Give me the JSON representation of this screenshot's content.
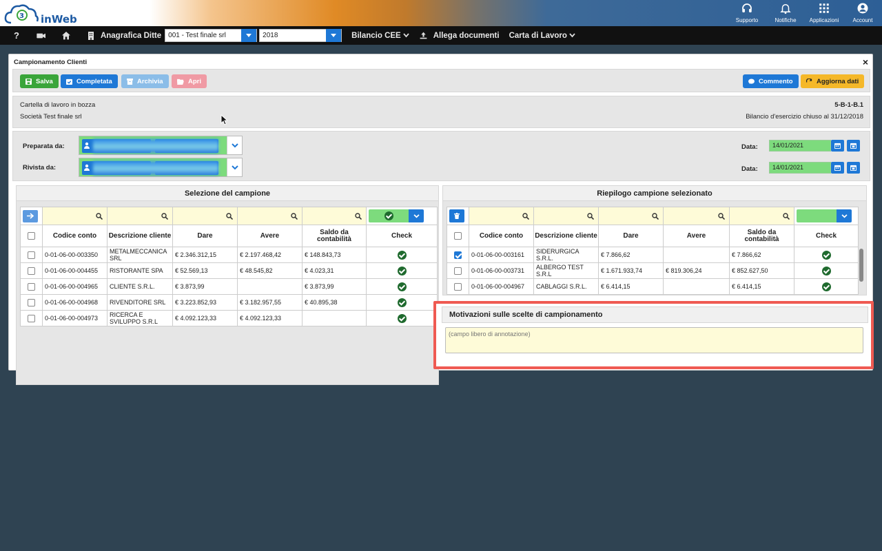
{
  "app": {
    "logo_text": "inWeb"
  },
  "topbar": {
    "items": [
      {
        "label": "Supporto",
        "icon": "headset-icon"
      },
      {
        "label": "Notifiche",
        "icon": "bell-icon"
      },
      {
        "label": "Applicazioni",
        "icon": "grid-icon"
      },
      {
        "label": "Account",
        "icon": "user-circle-icon"
      }
    ]
  },
  "navbar": {
    "help": "?",
    "anagrafica": "Anagrafica Ditte",
    "company_value": "001 - Test finale srl",
    "year_value": "2018",
    "bilancio": "Bilancio CEE",
    "allega": "Allega documenti",
    "carta": "Carta di Lavoro"
  },
  "panel": {
    "title": "Campionamento Clienti",
    "close": "×",
    "buttons": {
      "salva": "Salva",
      "completata": "Completata",
      "archivia": "Archivia",
      "apri": "Apri",
      "commento": "Commento",
      "aggiorna": "Aggiorna dati"
    },
    "info": {
      "status": "Cartella di lavoro in bozza",
      "company": "Società Test finale srl",
      "code": "5-B-1-B.1",
      "bilancio": "Bilancio d'esercizio chiuso al 31/12/2018"
    },
    "prep": {
      "preparata_label": "Preparata da:",
      "rivista_label": "Rivista da:",
      "data_label": "Data:",
      "date1": "14/01/2021",
      "date2": "14/01/2021"
    }
  },
  "left_grid": {
    "title": "Selezione del campione",
    "columns": [
      "Codice conto",
      "Descrizione cliente",
      "Dare",
      "Avere",
      "Saldo da contabilità",
      "Check"
    ],
    "rows": [
      {
        "codice": "0-01-06-00-003350",
        "desc": "METALMECCANICA SRL",
        "dare": "€ 2.346.312,15",
        "avere": "€ 2.197.468,42",
        "saldo": "€ 148.843,73"
      },
      {
        "codice": "0-01-06-00-004455",
        "desc": "RISTORANTE SPA",
        "dare": "€ 52.569,13",
        "avere": "€ 48.545,82",
        "saldo": "€ 4.023,31"
      },
      {
        "codice": "0-01-06-00-004965",
        "desc": "CLIENTE S.R.L.",
        "dare": "€ 3.873,99",
        "avere": "",
        "saldo": "€ 3.873,99"
      },
      {
        "codice": "0-01-06-00-004968",
        "desc": "RIVENDITORE SRL",
        "dare": "€ 3.223.852,93",
        "avere": "€ 3.182.957,55",
        "saldo": "€ 40.895,38"
      },
      {
        "codice": "0-01-06-00-004973",
        "desc": "RICERCA E SVILUPPO S.R.L",
        "dare": "€ 4.092.123,33",
        "avere": "€ 4.092.123,33",
        "saldo": ""
      }
    ]
  },
  "right_grid": {
    "title": "Riepilogo campione selezionato",
    "columns": [
      "Codice conto",
      "Descrizione cliente",
      "Dare",
      "Avere",
      "Saldo da contabilità",
      "Check"
    ],
    "rows": [
      {
        "codice": "0-01-06-00-003161",
        "desc": "SIDERURGICA S.R.L.",
        "dare": "€ 7.866,62",
        "avere": "",
        "saldo": "€ 7.866,62"
      },
      {
        "codice": "0-01-06-00-003731",
        "desc": "ALBERGO TEST S.R.L",
        "dare": "€ 1.671.933,74",
        "avere": "€ 819.306,24",
        "saldo": "€ 852.627,50"
      },
      {
        "codice": "0-01-06-00-004967",
        "desc": "CABLAGGI S.R.L.",
        "dare": "€ 6.414,15",
        "avere": "",
        "saldo": "€ 6.414,15"
      }
    ]
  },
  "motivazioni": {
    "title": "Motivazioni sulle scelte di campionamento",
    "placeholder": "(campo libero di annotazione)"
  },
  "colors": {
    "accent": "#1e78d6",
    "green": "#3aa53a",
    "highlight": "#ef5a52"
  }
}
